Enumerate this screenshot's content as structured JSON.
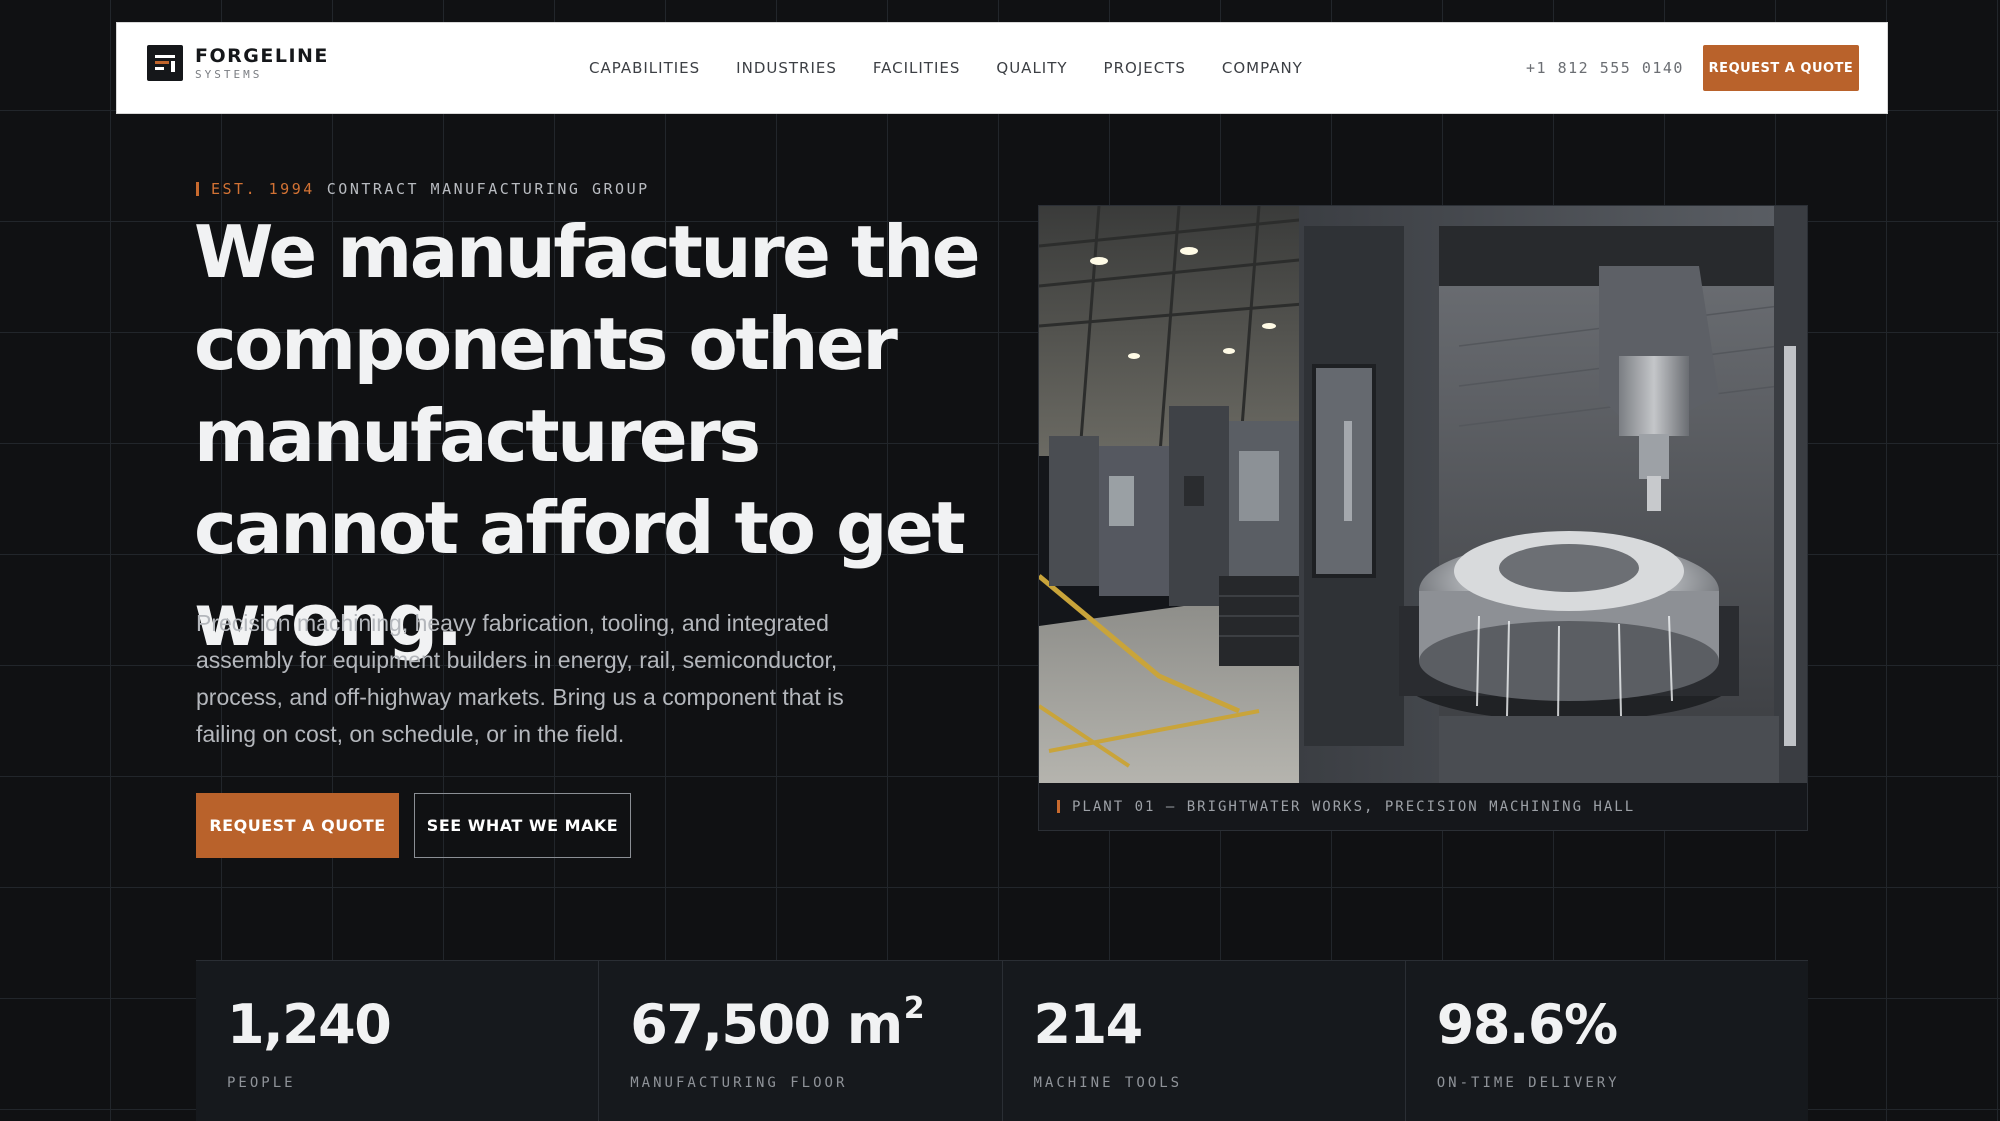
{
  "brand": {
    "name": "FORGELINE",
    "sub": "SYSTEMS"
  },
  "nav": {
    "links": [
      "CAPABILITIES",
      "INDUSTRIES",
      "FACILITIES",
      "QUALITY",
      "PROJECTS",
      "COMPANY"
    ],
    "phone": "+1 812 555 0140",
    "cta": "REQUEST A QUOTE"
  },
  "hero": {
    "eyebrow_accent": "EST. 1994",
    "eyebrow_rest": "CONTRACT MANUFACTURING GROUP",
    "headline": "We manufacture the components other manufacturers cannot afford to get wrong.",
    "lede": "Precision machining, heavy fabrication, tooling, and integrated assembly for equipment builders in energy, rail, semiconductor, process, and off-highway markets. Bring us a component that is failing on cost, on schedule, or in the field.",
    "primary_cta": "REQUEST A QUOTE",
    "secondary_cta": "SEE WHAT WE MAKE",
    "photo_caption": "PLANT 01 — BRIGHTWATER WORKS, PRECISION MACHINING HALL"
  },
  "stats": [
    {
      "value": "1,240",
      "sup": "",
      "label": "PEOPLE"
    },
    {
      "value": "67,500 m",
      "sup": "2",
      "label": "MANUFACTURING FLOOR"
    },
    {
      "value": "214",
      "sup": "",
      "label": "MACHINE TOOLS"
    },
    {
      "value": "98.6%",
      "sup": "",
      "label": "ON-TIME DELIVERY"
    }
  ],
  "colors": {
    "accent": "#b9622b",
    "background": "#101113",
    "nav_bg": "#ffffff"
  }
}
